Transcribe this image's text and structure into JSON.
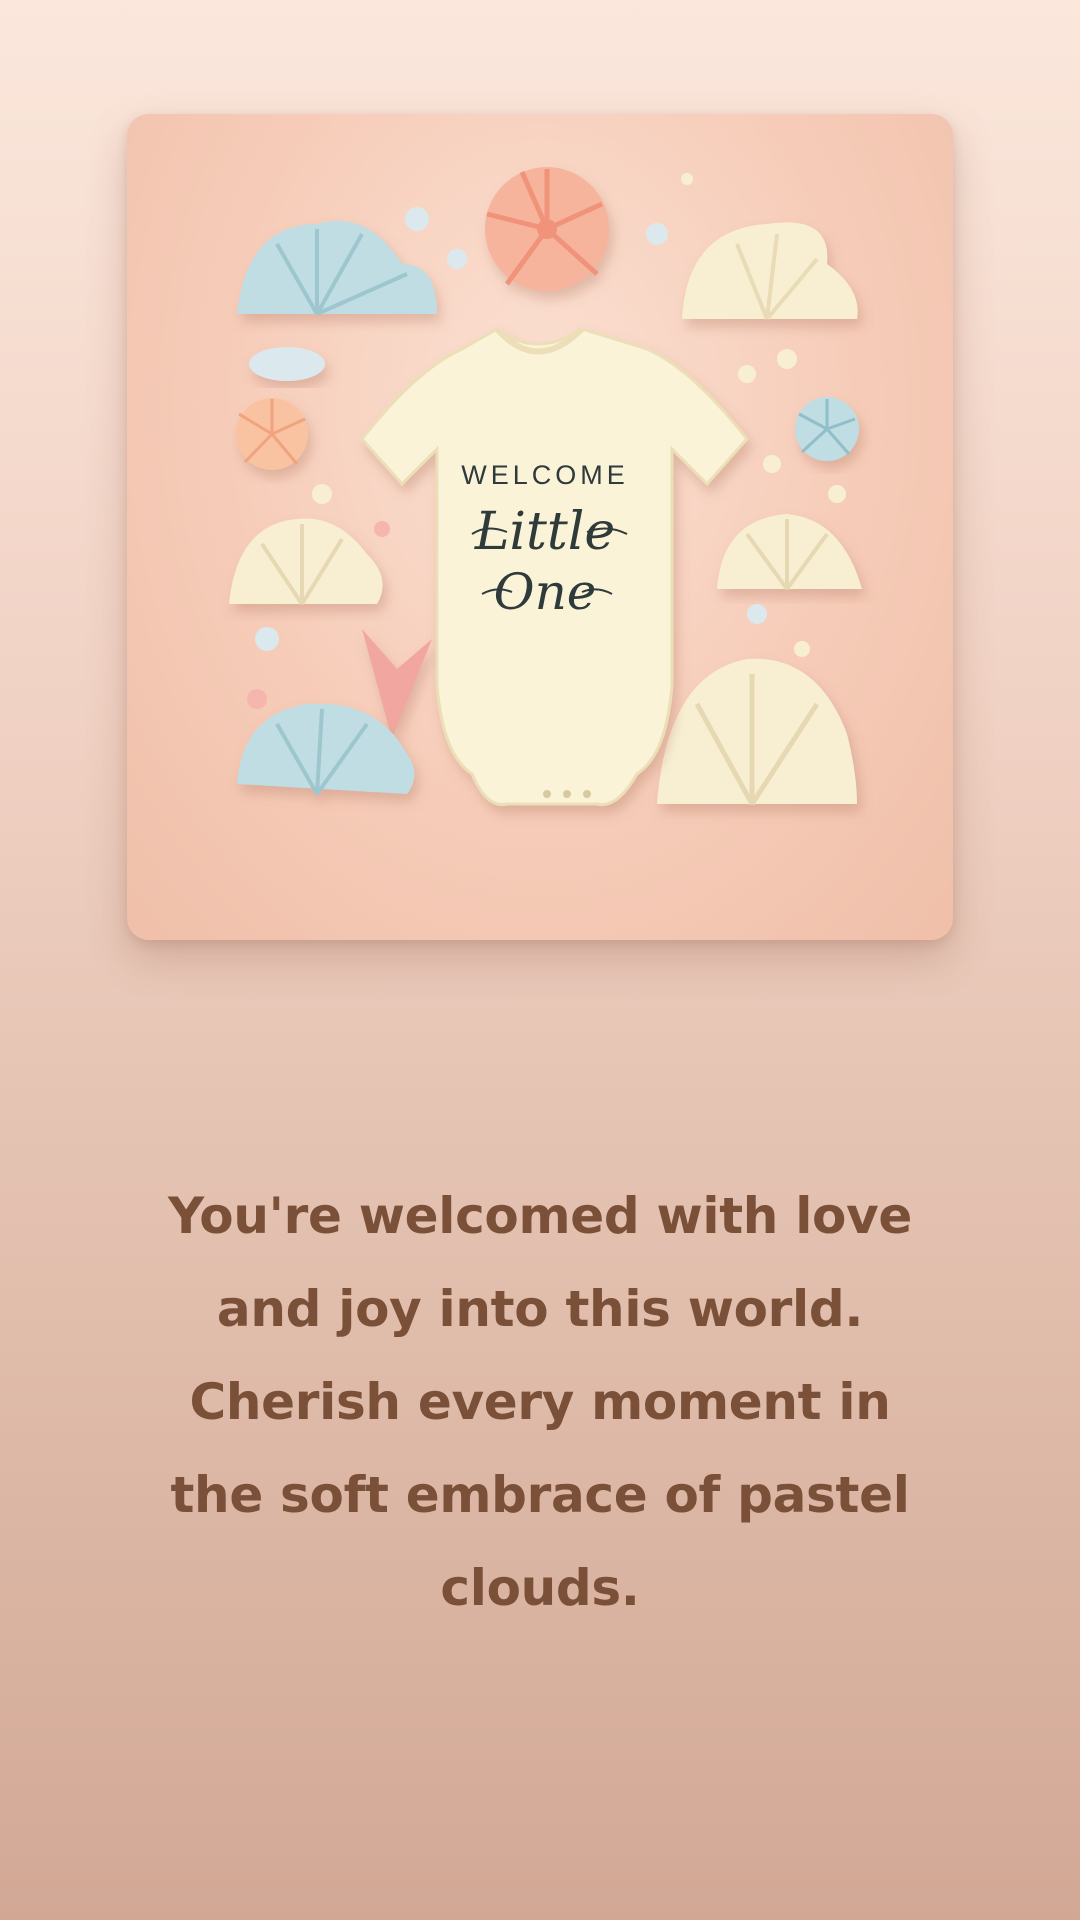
{
  "card": {
    "image_icon": "baby-onesie-paper-clouds-illustration",
    "onesie_text": {
      "line1": "WELCOME",
      "line2": "Little",
      "line3": "One"
    }
  },
  "message": {
    "lines": [
      "You're welcomed with love",
      "and joy into this world.",
      "Cherish every moment in",
      "the soft embrace of pastel",
      "clouds."
    ]
  },
  "colors": {
    "background_top": "#fbe7dc",
    "background_bottom": "#d2a895",
    "text": "#7a5038",
    "card_bg": "#f6ccb8",
    "onesie": "#fbf3d8",
    "cloud_blue": "#bfdde3",
    "cloud_cream": "#f8efd2",
    "cloud_peach": "#f7b49c"
  }
}
